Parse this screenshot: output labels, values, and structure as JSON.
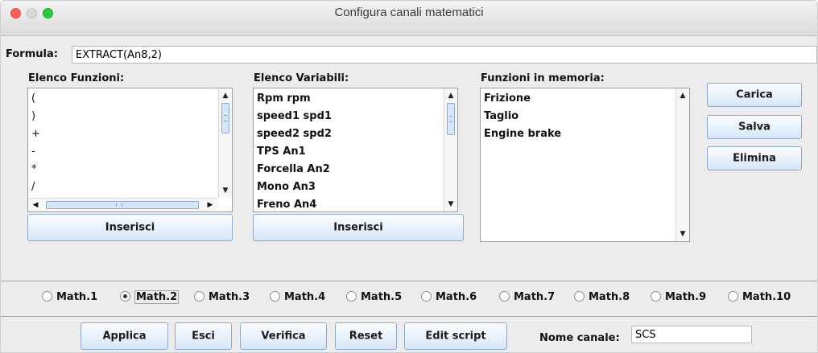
{
  "window": {
    "title": "Configura canali matematici"
  },
  "formula": {
    "label": "Formula:",
    "value": "EXTRACT(An8,2)"
  },
  "functions": {
    "label": "Elenco Funzioni:",
    "items": [
      "(",
      ")",
      "+",
      "-",
      "*",
      "/"
    ],
    "insert_button": "Inserisci"
  },
  "variables": {
    "label": "Elenco Variabili:",
    "items": [
      "Rpm rpm",
      "speed1 spd1",
      "speed2 spd2",
      "TPS An1",
      "Forcella An2",
      "Mono An3",
      "Freno An4"
    ],
    "insert_button": "Inserisci"
  },
  "memory": {
    "label": "Funzioni in memoria:",
    "items": [
      "Frizione",
      "Taglio",
      "Engine brake"
    ]
  },
  "side_buttons": {
    "load": "Carica",
    "save": "Salva",
    "delete": "Elimina"
  },
  "channels": {
    "selected": "Math.2",
    "options": [
      "Math.1",
      "Math.2",
      "Math.3",
      "Math.4",
      "Math.5",
      "Math.6",
      "Math.7",
      "Math.8",
      "Math.9",
      "Math.10"
    ]
  },
  "bottom_buttons": {
    "apply": "Applica",
    "exit": "Esci",
    "verify": "Verifica",
    "reset": "Reset",
    "edit_script": "Edit script"
  },
  "channel_name": {
    "label": "Nome canale:",
    "value": "SCS"
  },
  "colors": {
    "button_gradient_top": "#fbfdff",
    "button_gradient_bottom": "#d6e6f7",
    "window_bg": "#ececec",
    "close": "#fd5f57",
    "maximize": "#28c940"
  }
}
